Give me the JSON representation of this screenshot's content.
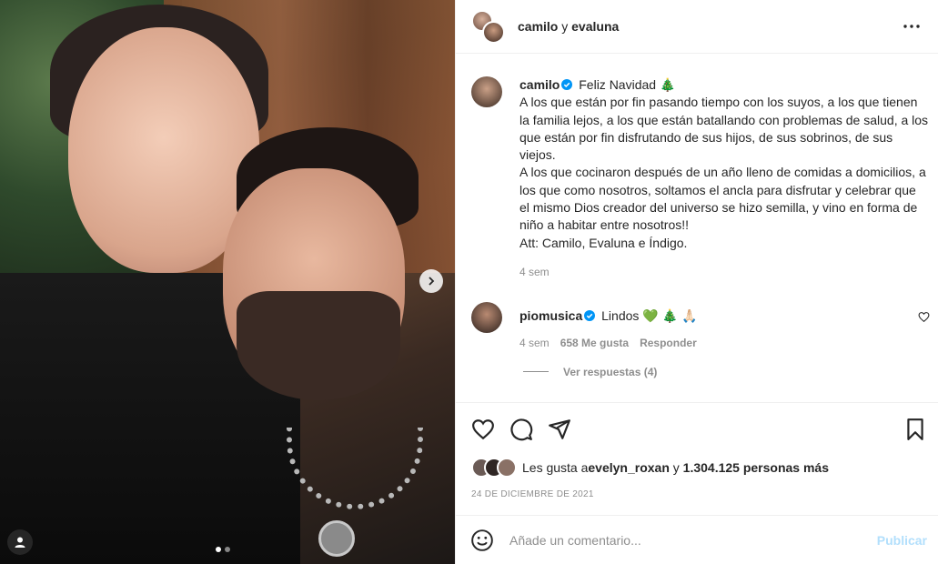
{
  "header": {
    "name1": "camilo",
    "connector": " y ",
    "name2": "evaluna",
    "more_icon": "more-horizontal-icon"
  },
  "caption": {
    "username": "camilo",
    "verified_icon": "verified-badge-icon",
    "text_first": "Feliz Navidad ",
    "emoji_first": "🎄",
    "paragraph1": "A los que están por fin pasando tiempo con los suyos, a los que tienen la familia lejos, a los que están batallando con problemas de salud, a los que están por fin disfrutando de sus hijos, de sus sobrinos, de sus viejos.",
    "paragraph2": "A los que cocinaron después de un año lleno de comidas a domicilios, a los que como nosotros, soltamos el ancla para disfrutar y celebrar que el mismo Dios creador del universo se hizo semilla, y vino en forma de niño a habitar entre nosotros!!",
    "paragraph3": "Att: Camilo, Evaluna e Índigo.",
    "time": "4 sem"
  },
  "reply": {
    "username": "piomusica",
    "text": "Lindos ",
    "emojis": "💚 🎄 🙏🏻",
    "time": "4 sem",
    "likes": "658 Me gusta",
    "reply_label": "Responder",
    "view_replies": "Ver respuestas (4)"
  },
  "likes": {
    "prefix": "Les gusta a ",
    "user": "evelyn_roxan",
    "middle": " y ",
    "count": "1.304.125 personas más"
  },
  "date": "24 DE DICIEMBRE DE 2021",
  "comment_box": {
    "placeholder": "Añade un comentario...",
    "post_label": "Publicar"
  },
  "colors": {
    "verified": "#0095f6",
    "post_disabled": "#b2dffc",
    "muted": "#8e8e8e",
    "text": "#262626"
  }
}
